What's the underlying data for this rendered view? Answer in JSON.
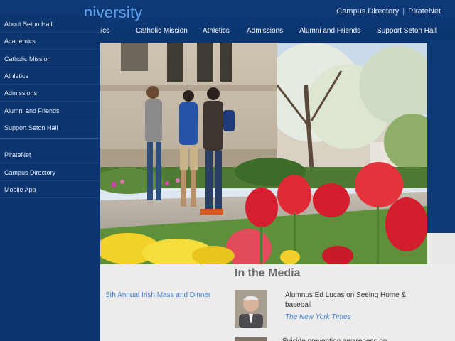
{
  "header": {
    "site_title": "niversity",
    "utility_links": [
      "Campus Directory",
      "PirateNet"
    ],
    "utility_separator": "|",
    "main_nav": [
      "emics",
      "Catholic Mission",
      "Athletics",
      "Admissions",
      "Alumni and Friends",
      "Support Seton Hall"
    ]
  },
  "sidebar": {
    "primary": [
      "About Seton Hall",
      "Academics",
      "Catholic Mission",
      "Athletics",
      "Admissions",
      "Alumni and Friends",
      "Support Seton Hall"
    ],
    "secondary": [
      "PirateNet",
      "Campus Directory",
      "Mobile App"
    ]
  },
  "events": {
    "item": "5th Annual Irish Mass and Dinner"
  },
  "media": {
    "heading": "In the Media",
    "items": [
      {
        "title": "Alumnus Ed Lucas on Seeing Home & baseball",
        "source": "The New York Times"
      },
      {
        "title": "Suicide prevention awareness on"
      }
    ]
  },
  "colors": {
    "header_blue": "#0f3a78",
    "title_blue": "#5fa3ea",
    "link_blue": "#3f7fd1",
    "sidebar_blue": "#0c3570"
  }
}
